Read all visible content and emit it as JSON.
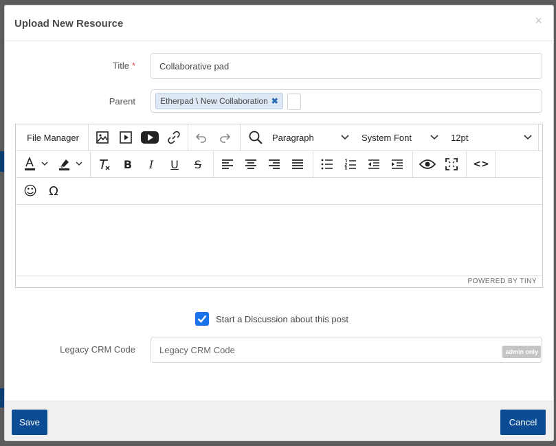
{
  "modal": {
    "title": "Upload New Resource",
    "close_symbol": "×"
  },
  "form": {
    "title_label": "Title",
    "required_mark": "*",
    "title_value": "Collaborative pad",
    "parent_label": "Parent",
    "parent_tag": "Etherpad \\ New Collaboration",
    "parent_tag_remove": "✖",
    "legacy_label": "Legacy CRM Code",
    "legacy_placeholder": "Legacy CRM Code",
    "legacy_badge": "admin only",
    "discussion_checked": true,
    "discussion_label": "Start a Discussion about this post"
  },
  "editor": {
    "file_manager": "File Manager",
    "block_format": "Paragraph",
    "font_family": "System Font",
    "font_size": "12pt",
    "powered_by": "POWERED BY TINY",
    "icons": {
      "image": "image-icon",
      "media": "media-icon",
      "youtube": "youtube-icon",
      "link": "link-icon",
      "undo": "undo-icon",
      "redo": "redo-icon",
      "search": "search-replace-icon",
      "text_color": "text-color-icon",
      "highlight": "highlight-icon",
      "clear_format": "clear-formatting-icon",
      "bold": "B",
      "italic": "I",
      "underline": "U",
      "strike": "S",
      "preview": "preview-icon",
      "fullscreen": "fullscreen-icon",
      "code": "<>",
      "emoji": "☺",
      "special_char": "Ω"
    }
  },
  "footer": {
    "save": "Save",
    "cancel": "Cancel"
  },
  "colors": {
    "primary": "#0b4c94",
    "checkbox": "#1a73e8",
    "required": "#d9534f"
  }
}
